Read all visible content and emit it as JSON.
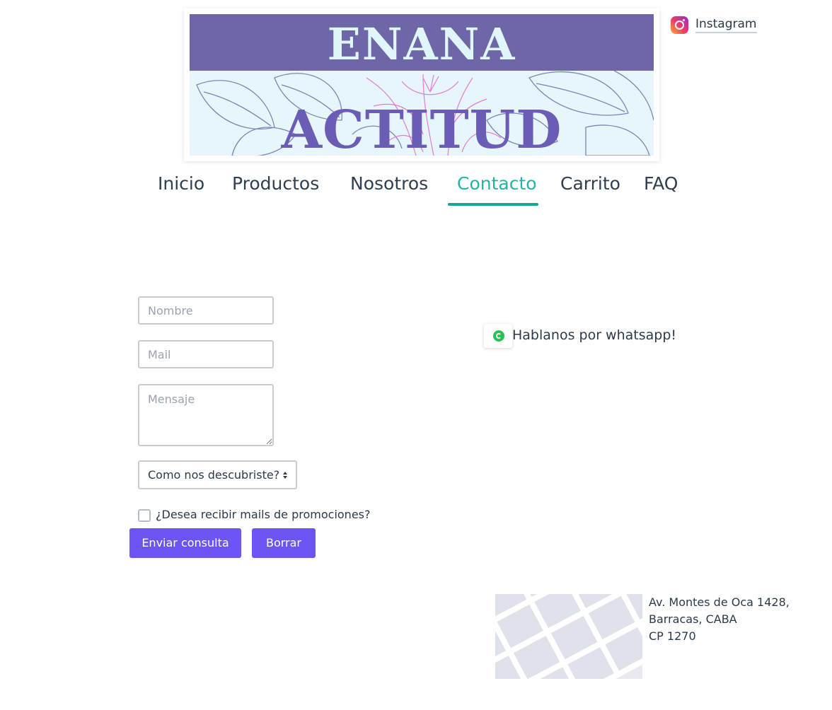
{
  "banner": {
    "title_top": "ENANA",
    "title_bottom": "ACTITUD"
  },
  "social": {
    "instagram_label": "Instagram",
    "icon": "instagram-icon"
  },
  "nav": {
    "items": [
      {
        "label": "Inicio"
      },
      {
        "label": "Productos"
      },
      {
        "label": "Nosotros"
      },
      {
        "label": "Contacto",
        "active": true
      },
      {
        "label": "Carrito"
      },
      {
        "label": "FAQ"
      }
    ]
  },
  "form": {
    "name_placeholder": "Nombre",
    "mail_placeholder": "Mail",
    "message_placeholder": "Mensaje",
    "source_select": "Como nos descubriste?",
    "promo_label": "¿Desea recibir mails de promociones?",
    "promo_checked": false,
    "submit_label": "Enviar consulta",
    "reset_label": "Borrar"
  },
  "whatsapp": {
    "label": "Hablanos por whatsapp!",
    "icon": "whatsapp-icon"
  },
  "address": {
    "line1": "Av. Montes de Oca 1428,",
    "line2": "Barracas, CABA",
    "line3": "CP 1270"
  },
  "colors": {
    "accent": "#6c55f3",
    "nav_active": "#25b3a3",
    "banner_band": "#6e66a6",
    "banner_title": "#6b5db6"
  }
}
